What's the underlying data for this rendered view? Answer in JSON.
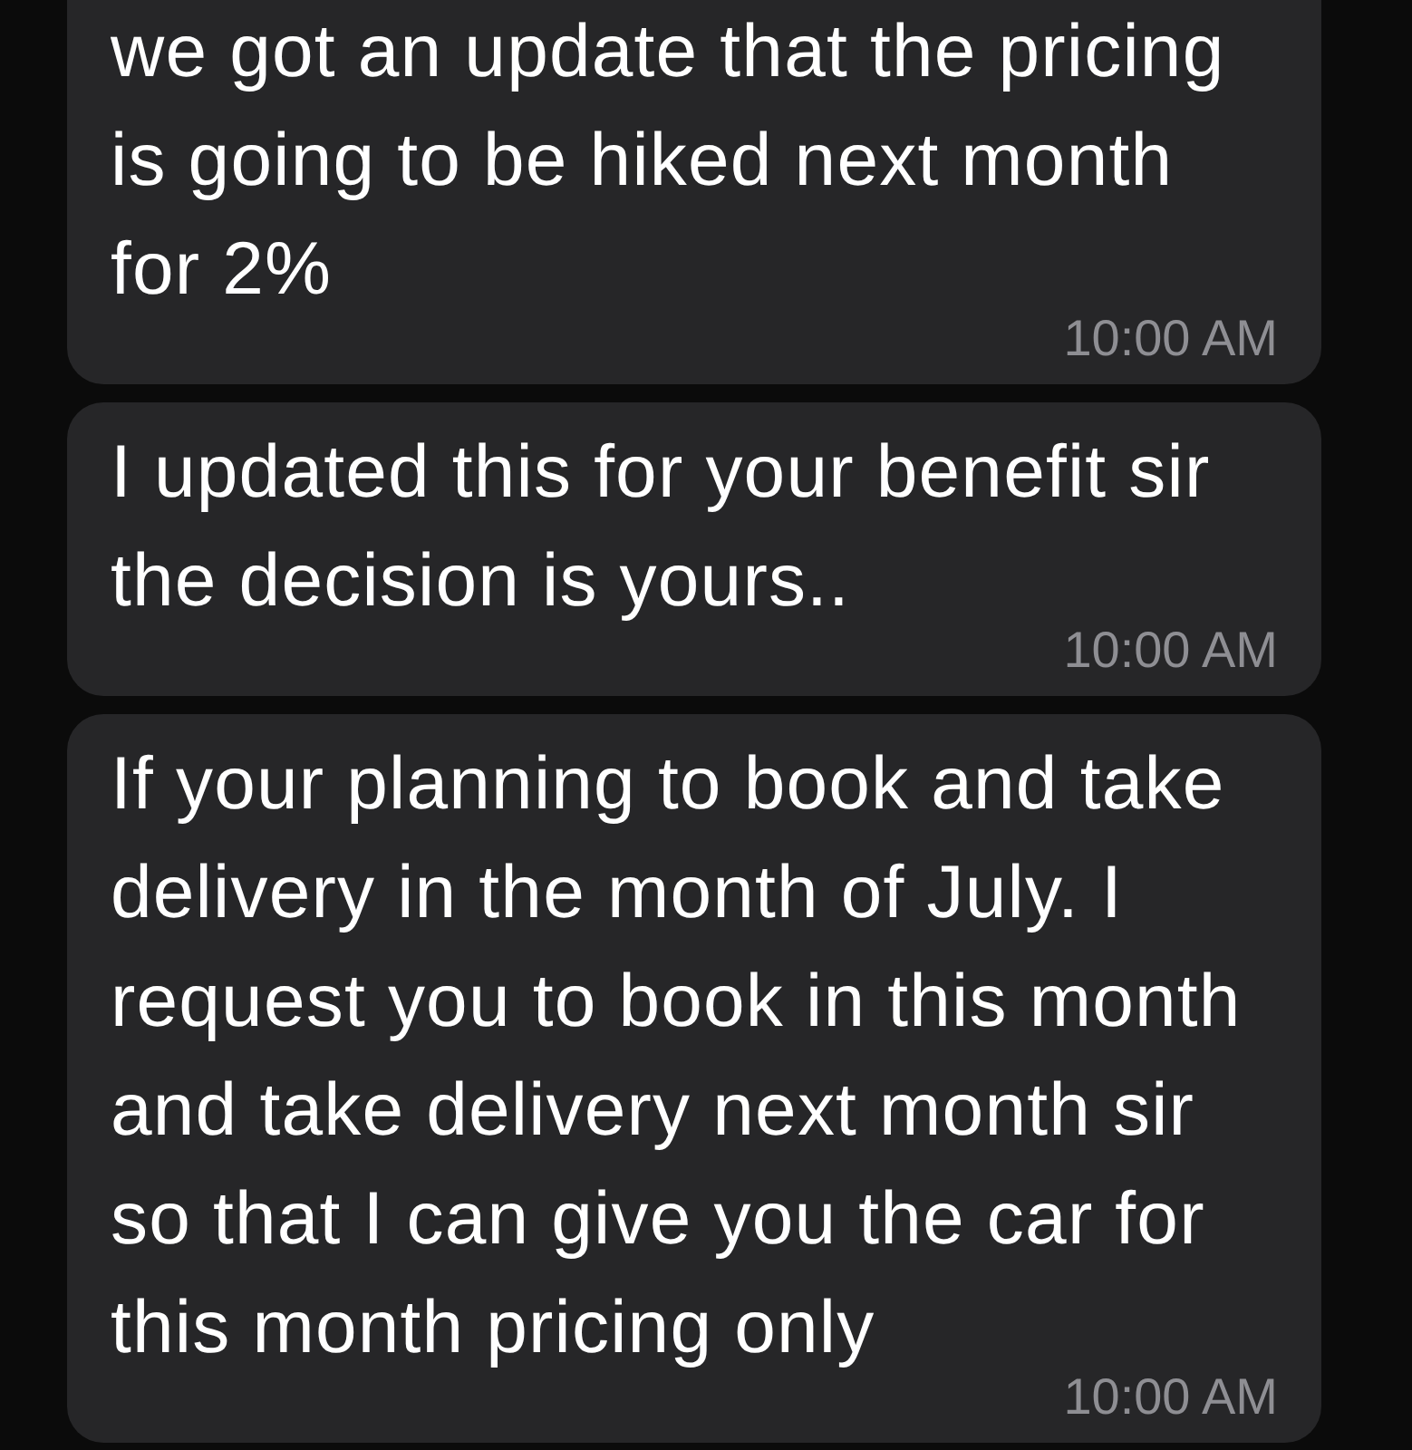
{
  "messages": [
    {
      "text": "we got an update that the pricing\nis going to be hiked next month\nfor 2%",
      "time": "10:00 AM"
    },
    {
      "text": "I updated this for your benefit sir\nthe decision is yours..",
      "time": "10:00 AM"
    },
    {
      "text": "If your planning to book and take\ndelivery in the month of July. I\nrequest you to book in this month\nand take delivery next month sir\nso that I can give you the car for\nthis month pricing only",
      "time": "10:00 AM"
    }
  ]
}
